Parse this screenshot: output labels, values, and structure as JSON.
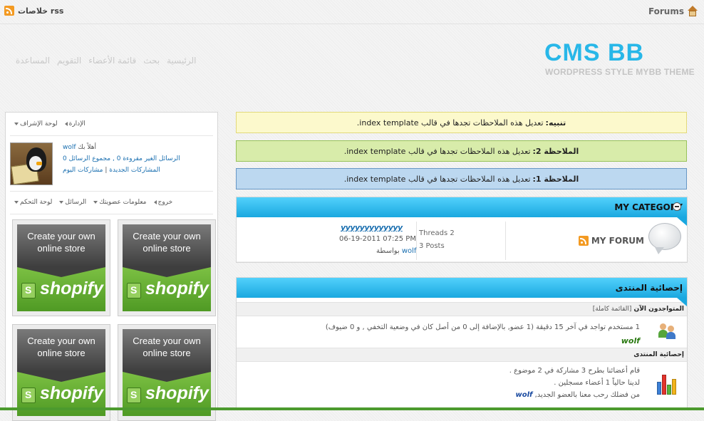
{
  "topbar": {
    "home_label": "Forums",
    "rss_label": "خلاصات rss"
  },
  "header": {
    "logo": "CMS BB",
    "tagline": "WORDPRESS STYLE MYBB THEME"
  },
  "nav": [
    "الرئيسية",
    "بحث",
    "قائمة الأعضاء",
    "التقويم",
    "المساعدة"
  ],
  "notices": {
    "yellow": {
      "label": "تنبيه:",
      "text": "تعديل هذه الملاحظات تجدها في قالب index template."
    },
    "green": {
      "label": "الملاحظة 2:",
      "text": "تعديل هذه الملاحظات تجدها في قالب index template."
    },
    "blue": {
      "label": "الملاحظة 1:",
      "text": "تعديل هذه الملاحظات تجدها في قالب index template."
    }
  },
  "category": {
    "title": "MY CATEGORY",
    "forum": {
      "name": "MY FORUM",
      "threads": "Threads 2",
      "posts": "3 Posts"
    },
    "lastpost": {
      "title": "yyyyyyyyyyyyy",
      "date": "06-19-2011 07:25 PM",
      "by_label": "بواسطة",
      "by_user": "wolf"
    }
  },
  "stats": {
    "title": "إحصائية المنتدى",
    "online_header": "المتواجدون الآن",
    "online_full_list": "[القائمة كاملة]",
    "online_text": "1 مستخدم تواجد في آخر 15 دقيقة (1 عضو, بالإضافة إلى 0 من أصل كان في وضعية التخفي , و 0 ضيوف)",
    "online_user": "wolf",
    "stats_header": "إحصائية المنتدى",
    "line1": "قام أعضائنا بطرح 3 مشاركة في 2 موضوع .",
    "line2": "لدينا حالياً 1 أعضاء مسجلين .",
    "line3_prefix": "من فضلك رحب معنا بالعضو الجديد,",
    "line3_user": "wolf"
  },
  "sidebar": {
    "admin_menu": [
      "الإدارة",
      "لوحة الإشراف"
    ],
    "welcome_label": "أهلاً بك",
    "username": "wolf",
    "line2": "الرسائل الغير مقروءة 0 , مجموع الرسائل 0",
    "line3_new": "المشاركات الجديدة",
    "line3_today": "مشاركات اليوم",
    "user_menu": [
      "خروج",
      "معلومات عضويتك",
      "الرسائل",
      "لوحة التحكم"
    ],
    "ads": [
      {
        "line1": "Create your own",
        "line2": "online store",
        "brand": "shopify"
      },
      {
        "line1": "Create your own",
        "line2": "online store",
        "brand": "shopify"
      },
      {
        "line1": "Create your own",
        "line2": "online store",
        "brand": "shopify"
      },
      {
        "line1": "Create your own",
        "line2": "online store",
        "brand": "shopify"
      }
    ]
  },
  "icons": [
    "home-icon",
    "rss-icon",
    "expand-icon",
    "forum-bubble-icon",
    "users-icon",
    "bar-chart-icon"
  ],
  "colors": {
    "accent": "#1aa8e0",
    "logo": "#28b7e8",
    "notice_yellow": "#fcf9cc",
    "notice_green": "#d8ecaa",
    "notice_blue": "#bcd8f0",
    "shopify_green": "#5ea72e"
  }
}
